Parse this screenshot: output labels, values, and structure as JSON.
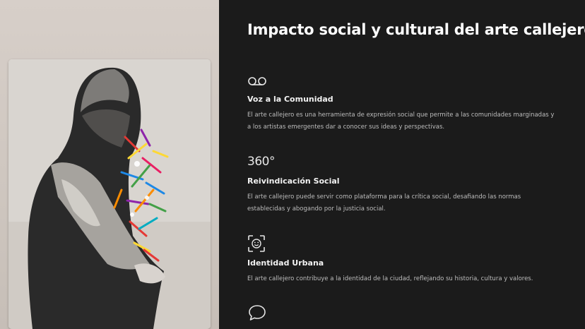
{
  "title": "Impacto social y cultural del arte callejero",
  "artwork": {
    "alt_icon": "street-art-hooded-figure"
  },
  "features": [
    {
      "icon": "voicemail-icon",
      "heading": "Voz a la Comunidad",
      "body": "El arte callejero es una herramienta de expresión social que permite a las comunidades marginadas y a los artistas emergentes dar a conocer sus ideas y perspectivas."
    },
    {
      "icon": "360-icon",
      "icon_text": "360°",
      "heading": "Reivindicación Social",
      "body": "El arte callejero puede servir como plataforma para la crítica social, desafiando las normas establecidas y abogando por la justicia social."
    },
    {
      "icon": "face-scan-icon",
      "heading": "Identidad Urbana",
      "body": "El arte callejero contribuye a la identidad de la ciudad, reflejando su historia, cultura y valores."
    },
    {
      "icon": "chat-bubble-icon"
    }
  ],
  "colors": {
    "background": "#1b1b1b",
    "title": "#ffffff",
    "body_text": "#bdbdbd",
    "left_panel": "#d7cfc9"
  }
}
